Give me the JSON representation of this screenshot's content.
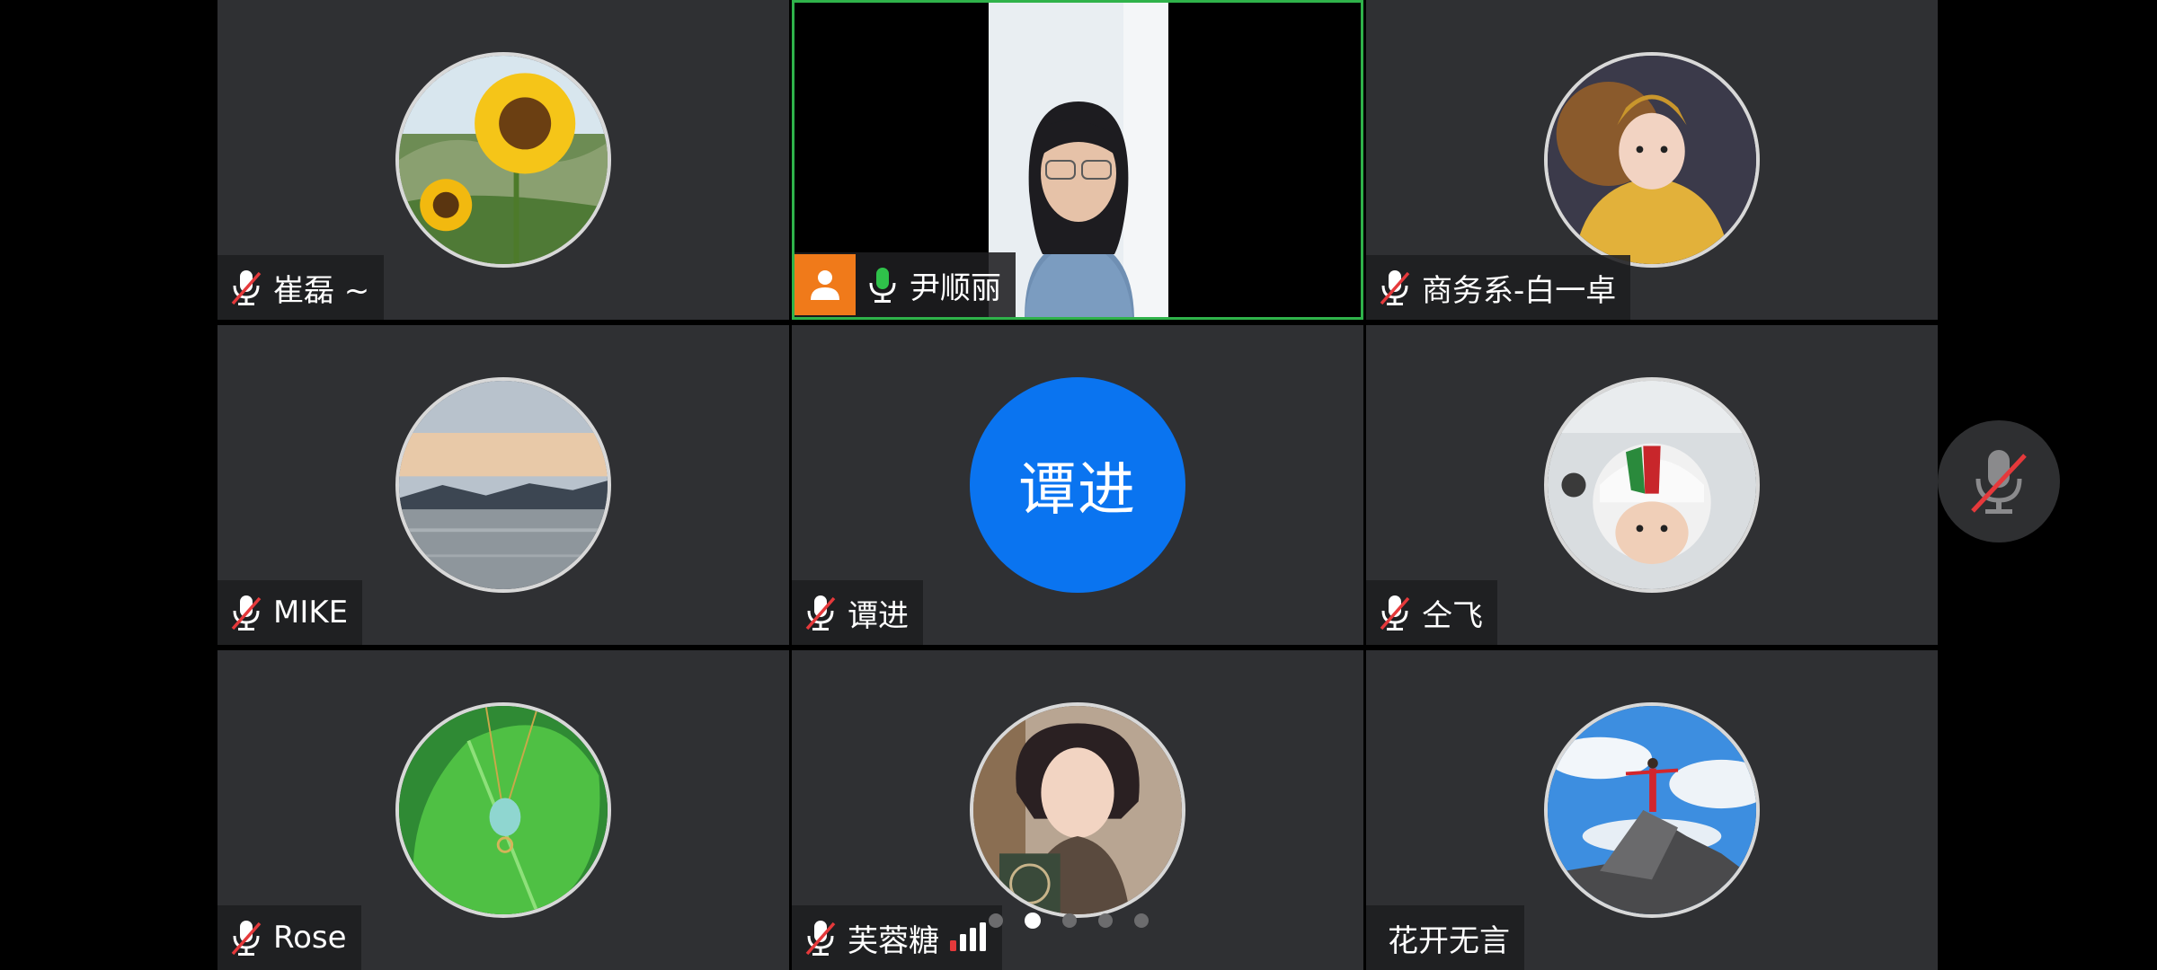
{
  "participants": [
    {
      "name": "崔磊 ~",
      "mic": "muted",
      "avatar": "sunflower-photo"
    },
    {
      "name": "尹顺丽",
      "mic": "active",
      "avatar": "video-feed",
      "host": true
    },
    {
      "name": "商务系-白一卓",
      "mic": "muted",
      "avatar": "costume-child-photo"
    },
    {
      "name": "MIKE",
      "mic": "muted",
      "avatar": "lake-sunset-photo"
    },
    {
      "name": "谭进",
      "mic": "muted",
      "avatar": "text",
      "avatar_text": "谭进"
    },
    {
      "name": "仝飞",
      "mic": "muted",
      "avatar": "child-helmet-photo"
    },
    {
      "name": "Rose",
      "mic": "muted",
      "avatar": "leaf-pendant-photo"
    },
    {
      "name": "芙蓉糖",
      "mic": "muted",
      "avatar": "woman-portrait-photo",
      "signal": "weak"
    },
    {
      "name": "花开无言",
      "mic": "none",
      "avatar": "rock-sky-photo"
    }
  ],
  "pager": {
    "total": 5,
    "current": 2
  },
  "colors": {
    "tile_bg": "#2f3033",
    "active_border": "#2fb24a",
    "muted_red": "#e5393b",
    "active_mic_green": "#2fc24a",
    "host_badge": "#f07a1a",
    "text_avatar_bg": "#0a74f0"
  },
  "icons": {
    "muted_mic": "mic-muted-icon",
    "active_mic": "mic-icon",
    "host": "person-icon",
    "signal": "signal-bars-icon"
  }
}
